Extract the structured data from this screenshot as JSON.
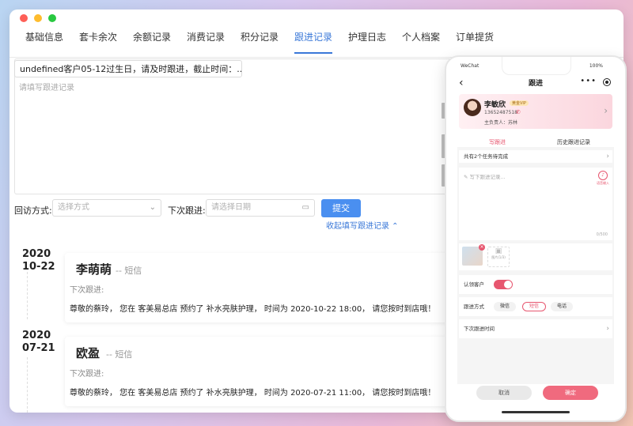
{
  "tabs": [
    "基础信息",
    "套卡余次",
    "余额记录",
    "消费记录",
    "积分记录",
    "跟进记录",
    "护理日志",
    "个人档案",
    "订单提货"
  ],
  "active_tab": "跟进记录",
  "form": {
    "notice_value": "undefined客户05-12过生日，请及时跟进，截止时间：...",
    "textarea_placeholder": "请填写跟进记录",
    "visit_method_label": "回访方式:",
    "visit_method_placeholder": "选择方式",
    "next_follow_label": "下次跟进:",
    "next_follow_placeholder": "请选择日期",
    "submit_label": "提交",
    "collapse_label": "收起填写跟进记录 ⌃"
  },
  "records": [
    {
      "year": "2020",
      "date": "10-22",
      "name": "李萌萌",
      "channel": "-- 短信",
      "next_label": "下次跟进:",
      "message": "尊敬的蔡玲， 您在 客美易总店 预约了 补水亮肤护理， 时间为 2020-10-22 18:00， 请您按时到店哦！"
    },
    {
      "year": "2020",
      "date": "07-21",
      "name": "欧盈",
      "channel": "-- 短信",
      "next_label": "下次跟进:",
      "message": "尊敬的蔡玲， 您在 客美易总店 预约了 补水亮肤护理， 时间为 2020-07-21 11:00， 请您按时到店哦！"
    }
  ],
  "phone": {
    "carrier": "WeChat",
    "battery": "100%",
    "title": "跟进",
    "customer_name": "李敏欣",
    "vip_badge": "黄金VIP",
    "customer_phone": "13652487518",
    "owner": "主负责人：苏林",
    "tabs": [
      "写跟进",
      "历史跟进记录"
    ],
    "tasks_text": "共有2个任务待完成",
    "write_placeholder": "写下跟进记录...",
    "voice_label": "语音输入",
    "char_count": "0/500",
    "photo_label": "图片(1/3)",
    "recognized_label": "认领客户",
    "method_label": "跟进方式",
    "methods": [
      "微信",
      "短信",
      "电话"
    ],
    "active_method": "短信",
    "next_time_label": "下次跟进时间",
    "cancel_label": "取消",
    "confirm_label": "确定"
  },
  "colors": {
    "accent_blue": "#3a78d8",
    "button_blue": "#4a8ff0",
    "accent_pink": "#e7566f"
  }
}
